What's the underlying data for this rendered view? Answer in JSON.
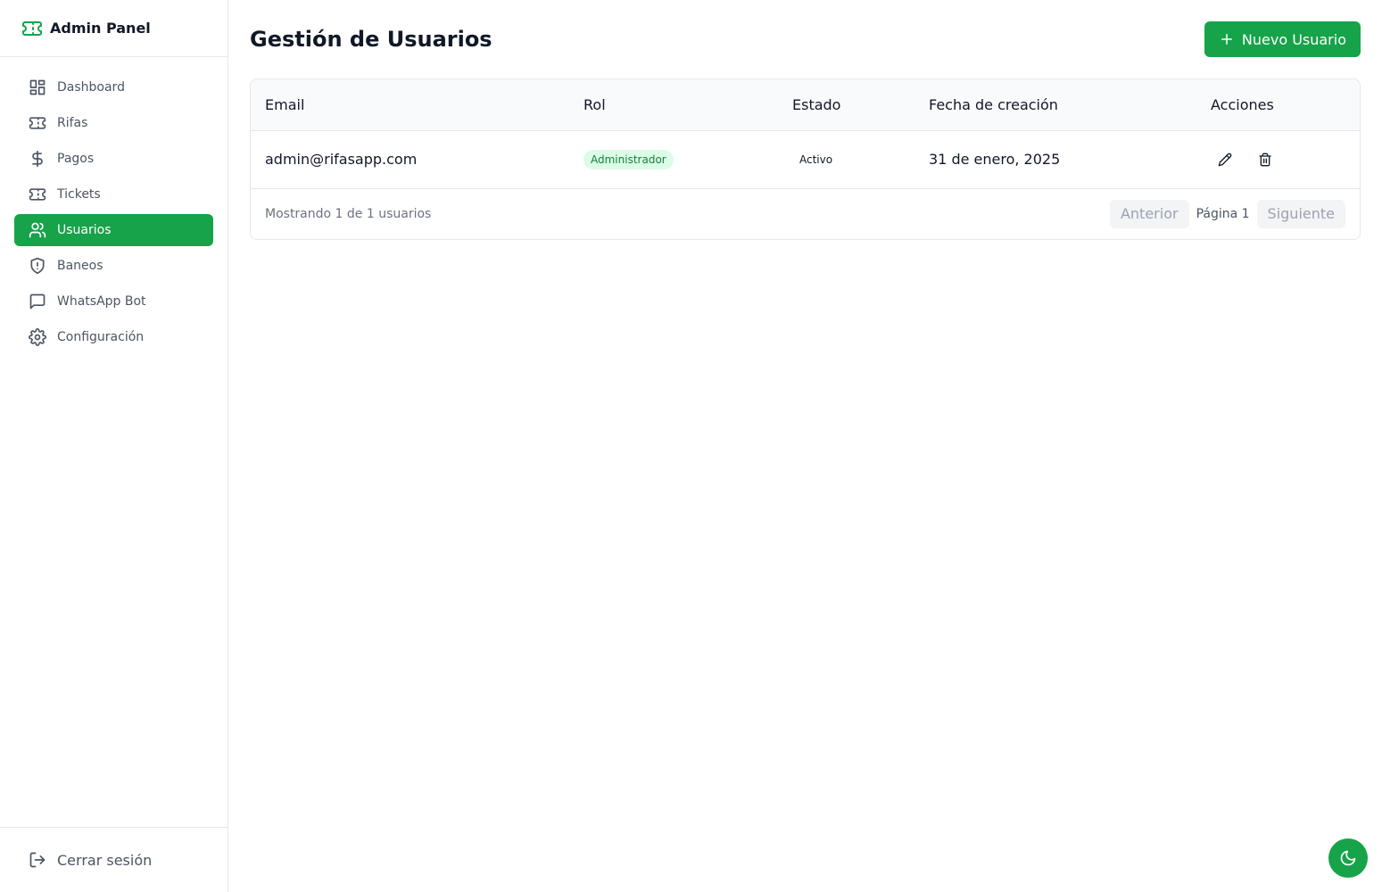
{
  "app": {
    "brand_title": "Admin Panel",
    "brand_icon": "ticket-icon",
    "accent_color": "#16a34a"
  },
  "sidebar": {
    "items": [
      {
        "label": "Dashboard",
        "icon": "dashboard-icon",
        "active": false
      },
      {
        "label": "Rifas",
        "icon": "ticket-icon",
        "active": false
      },
      {
        "label": "Pagos",
        "icon": "dollar-icon",
        "active": false
      },
      {
        "label": "Tickets",
        "icon": "ticket-icon",
        "active": false
      },
      {
        "label": "Usuarios",
        "icon": "users-icon",
        "active": true
      },
      {
        "label": "Baneos",
        "icon": "shield-icon",
        "active": false
      },
      {
        "label": "WhatsApp Bot",
        "icon": "message-icon",
        "active": false
      },
      {
        "label": "Configuración",
        "icon": "gear-icon",
        "active": false
      }
    ],
    "logout_label": "Cerrar sesión",
    "logout_icon": "logout-icon"
  },
  "main": {
    "title": "Gestión de Usuarios",
    "new_user_label": "Nuevo Usuario",
    "new_user_icon": "plus-icon",
    "table": {
      "columns": [
        "Email",
        "Rol",
        "Estado",
        "Fecha de creación",
        "Acciones"
      ],
      "rows": [
        {
          "email": "admin@rifasapp.com",
          "role": "Administrador",
          "status": "Activo",
          "created": "31 de enero, 2025",
          "actions": [
            "pencil-icon",
            "trash-icon"
          ]
        }
      ]
    },
    "footer": {
      "info": "Mostrando 1 de 1 usuarios",
      "prev_label": "Anterior",
      "page_label": "Página 1",
      "next_label": "Siguiente"
    }
  },
  "theme_toggle_icon": "moon-icon"
}
